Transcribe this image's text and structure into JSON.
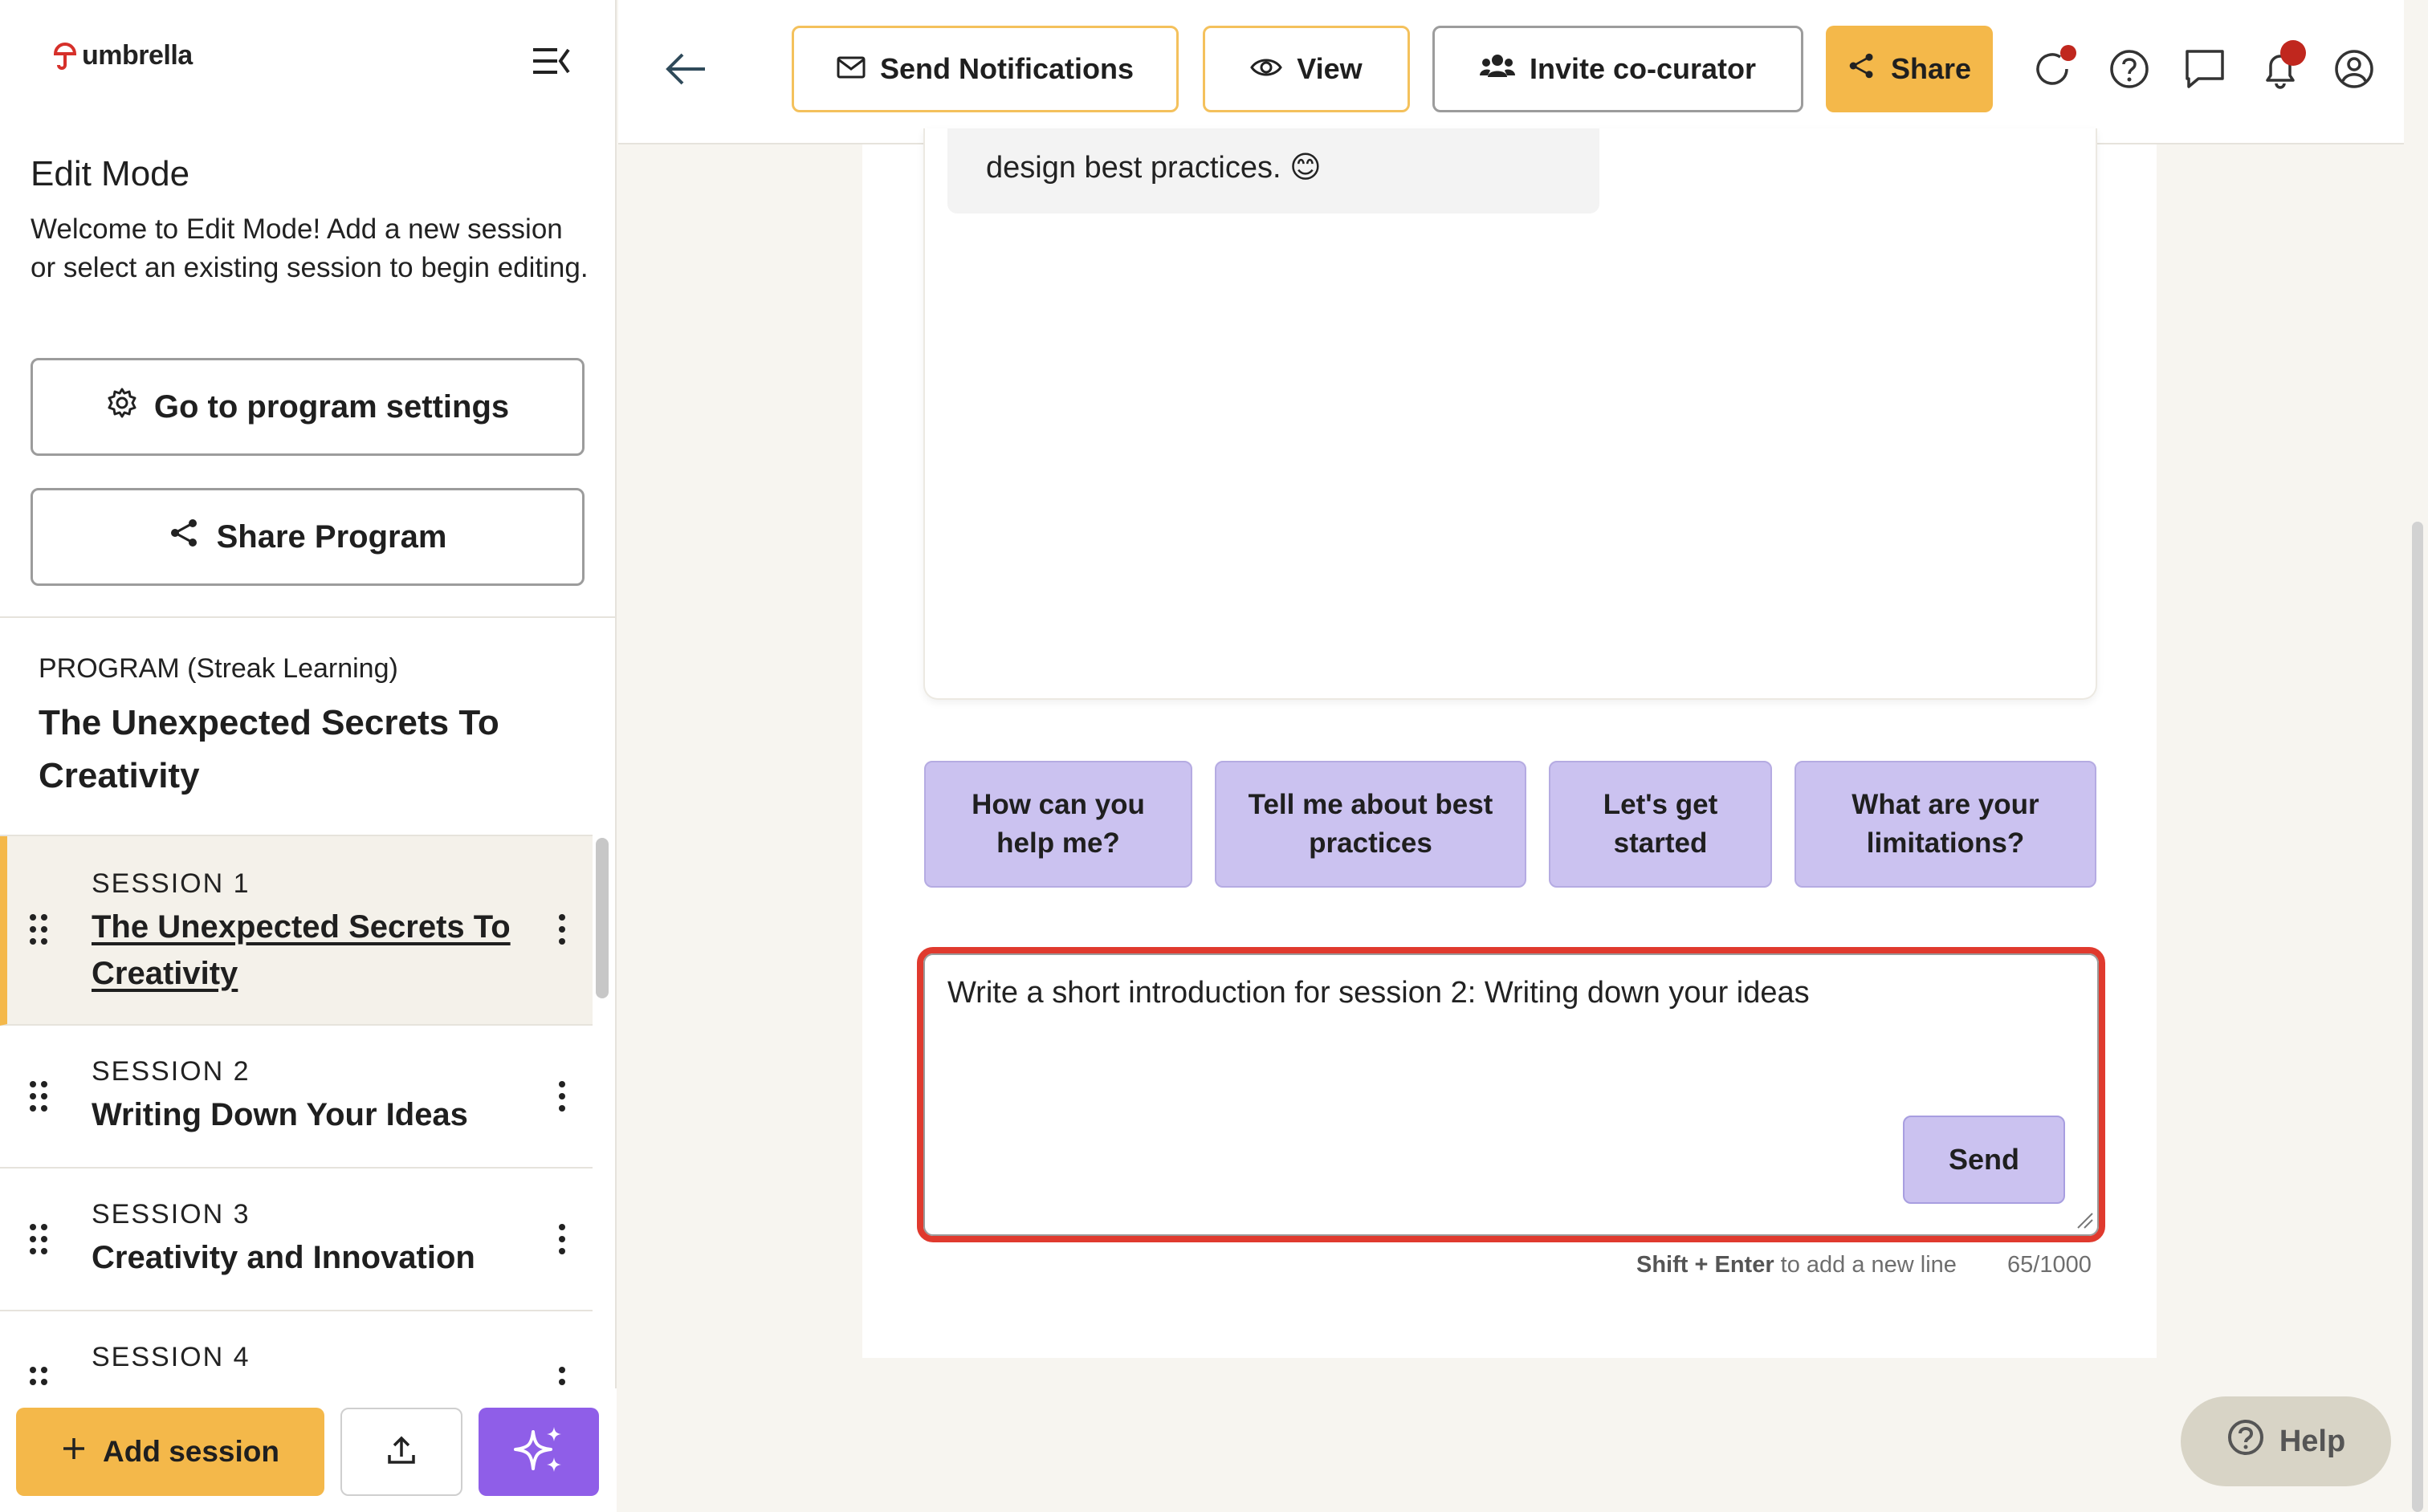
{
  "brand": {
    "name": "umbrella"
  },
  "sidebar": {
    "edit_title": "Edit Mode",
    "edit_description": "Welcome to Edit Mode! Add a new session or select an existing session to begin editing.",
    "settings_button": "Go to program settings",
    "share_program_button": "Share Program",
    "program_kicker": "PROGRAM (Streak Learning)",
    "program_title": "The Unexpected Secrets To Creativity",
    "sessions": [
      {
        "kicker": "SESSION 1",
        "title": "The Unexpected Secrets To Creativity",
        "active": true
      },
      {
        "kicker": "SESSION 2",
        "title": "Writing Down Your Ideas",
        "active": false
      },
      {
        "kicker": "SESSION 3",
        "title": "Creativity and Innovation",
        "active": false
      },
      {
        "kicker": "SESSION 4",
        "title": "",
        "active": false
      }
    ],
    "add_session_button": "Add session"
  },
  "toolbar": {
    "send_notifications": "Send Notifications",
    "view": "View",
    "invite": "Invite co-curator",
    "share": "Share"
  },
  "chat": {
    "bubble_text": "design best practices. 😊",
    "suggestions": [
      "How can you help me?",
      "Tell me about best practices",
      "Let's get started",
      "What are your limitations?"
    ],
    "input_value": "Write a short introduction for session 2: Writing down your ideas",
    "send_button": "Send",
    "hint_keys": "Shift + Enter",
    "hint_text": " to add a new line",
    "counter": "65/1000"
  },
  "help": {
    "label": "Help"
  },
  "colors": {
    "accent_yellow": "#f4b84a",
    "chip_purple": "#cbc2f0",
    "ai_purple": "#8f5ee8",
    "highlight_red": "#e03a2e",
    "notification_dot": "#c0271e"
  },
  "icons": [
    "umbrella-logo-icon",
    "collapse-menu-icon",
    "gear-icon",
    "share-icon",
    "drag-handle-icon",
    "more-vertical-icon",
    "plus-icon",
    "upload-icon",
    "sparkle-icon",
    "back-arrow-icon",
    "mail-icon",
    "eye-icon",
    "users-icon",
    "refresh-icon",
    "help-circle-icon",
    "chat-icon",
    "bell-icon",
    "user-circle-icon",
    "question-icon"
  ]
}
